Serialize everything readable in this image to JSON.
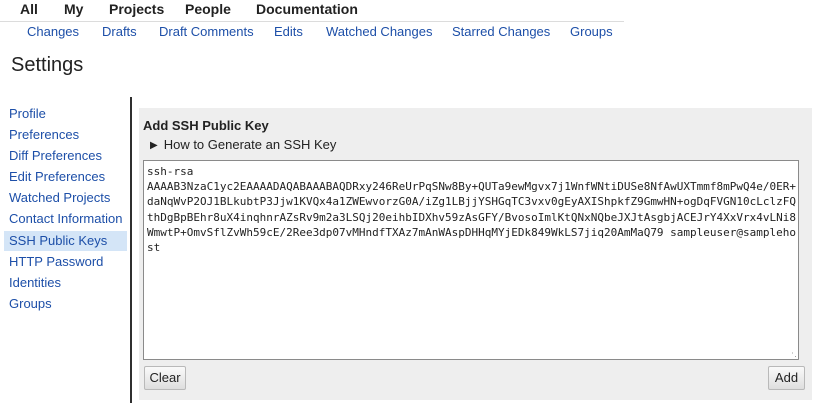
{
  "topnav": {
    "items": [
      "All",
      "My",
      "Projects",
      "People",
      "Documentation"
    ]
  },
  "subnav": {
    "items": [
      "Changes",
      "Drafts",
      "Draft Comments",
      "Edits",
      "Watched Changes",
      "Starred Changes",
      "Groups"
    ]
  },
  "page": {
    "title": "Settings"
  },
  "sidebar": {
    "items": [
      {
        "label": "Profile"
      },
      {
        "label": "Preferences"
      },
      {
        "label": "Diff Preferences"
      },
      {
        "label": "Edit Preferences"
      },
      {
        "label": "Watched Projects"
      },
      {
        "label": "Contact Information"
      },
      {
        "label": "SSH Public Keys"
      },
      {
        "label": "HTTP Password"
      },
      {
        "label": "Identities"
      },
      {
        "label": "Groups"
      }
    ],
    "active": "SSH Public Keys"
  },
  "panel": {
    "title": "Add SSH Public Key",
    "disclosure_label": "How to Generate an SSH Key",
    "key_value": "ssh-rsa\nAAAAB3NzaC1yc2EAAAADAQABAAABAQDRxy246ReUrPqSNw8By+QUTa9ewMgvx7j1WnfWNtiDUSe8NfAwUXTmmf8mPwQ4e/0ER+daNqWvP2OJ1BLkubtP3Jjw1KVQx4a1ZWEwvorzG0A/iZg1LBjjYSHGqTC3vxv0gEyAXIShpkfZ9GmwHN+ogDqFVGN10cLclzFQthDgBpBEhr8uX4inqhnrAZsRv9m2a3LSQj20eihbIDXhv59zAsGFY/BvosoImlKtQNxNQbeJXJtAsgbjACEJrY4XxVrx4vLNi8WmwtP+OmvSflZvWh59cE/2Ree3dp07vMHndfTXAz7mAnWAspDHHqMYjEDk849WkLS7jiq20AmMaQ79 sampleuser@samplehost",
    "clear_label": "Clear",
    "add_label": "Add"
  }
}
